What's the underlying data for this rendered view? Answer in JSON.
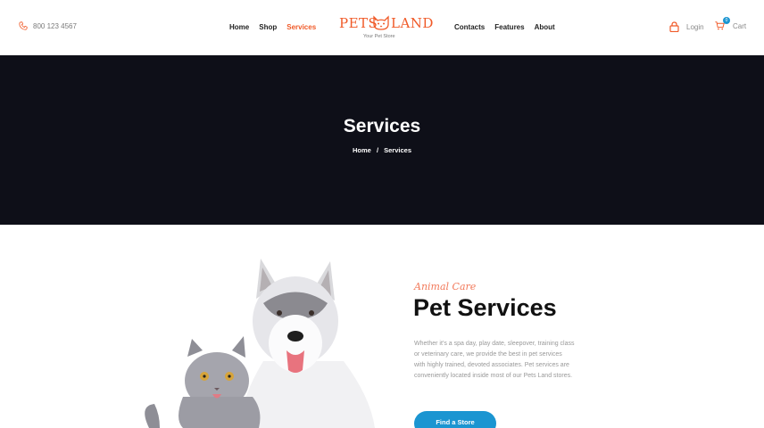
{
  "header": {
    "phone": "800 123 4567",
    "nav_left": [
      "Home",
      "Shop",
      "Services"
    ],
    "nav_right": [
      "Contacts",
      "Features",
      "About"
    ],
    "active_nav": "Services",
    "logo_left": "PETS",
    "logo_right": "LAND",
    "logo_tagline": "Your Pet Store",
    "login_label": "Login",
    "cart_label": "Cart",
    "cart_count": "0"
  },
  "hero": {
    "title": "Services",
    "breadcrumb": [
      "Home",
      "/",
      "Services"
    ]
  },
  "content": {
    "script_title": "Animal Care",
    "heading": "Pet Services",
    "description": "Whether it’s a spa day, play date, sleepover, training class or veterinary care, we provide the best in pet services with highly trained, devoted associates. Pet services are conveniently located inside most of our Pets Land stores.",
    "button_label": "Find a Store"
  },
  "colors": {
    "accent": "#f05a28",
    "hero_bg": "#0e0f18",
    "button": "#1b95d1"
  }
}
